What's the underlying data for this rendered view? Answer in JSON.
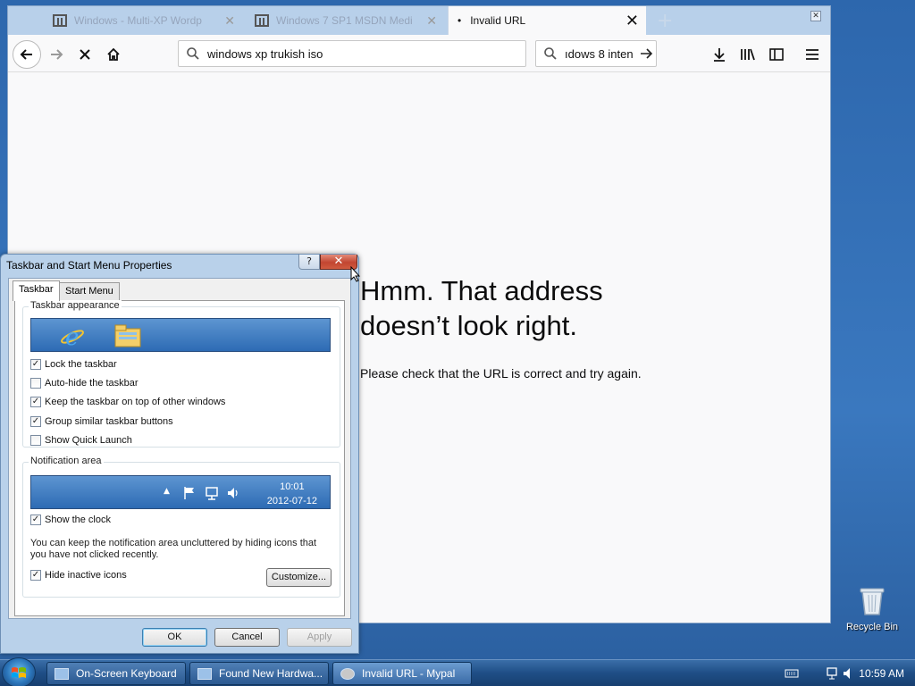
{
  "browser": {
    "tabs": [
      {
        "label": "Windows - Multi-XP Wordp",
        "close": "✕"
      },
      {
        "label": "Windows 7 SP1 MSDN Medi",
        "close": "✕"
      },
      {
        "label": "Invalid URL",
        "close": "✕"
      }
    ],
    "new_tab": "+",
    "url_value": "windows xp trukish iso",
    "search_value": "ıdows 8 inten",
    "error_title": "Hmm. That address doesn’t look right.",
    "error_desc": "Please check that the URL is correct and try again."
  },
  "dialog": {
    "title": "Taskbar and Start Menu Properties",
    "help": "?",
    "tabs": [
      "Taskbar",
      "Start Menu"
    ],
    "appearance_group": "Taskbar appearance",
    "options": [
      {
        "label": "Lock the taskbar",
        "checked": true
      },
      {
        "label": "Auto-hide the taskbar",
        "checked": false
      },
      {
        "label": "Keep the taskbar on top of other windows",
        "checked": true
      },
      {
        "label": "Group similar taskbar buttons",
        "checked": true
      },
      {
        "label": "Show Quick Launch",
        "checked": false
      }
    ],
    "notification_group": "Notification area",
    "preview_time": "10:01",
    "preview_date": "2012-07-12",
    "show_clock": "Show the clock",
    "note": "You can keep the notification area uncluttered by hiding icons that you have not clicked recently.",
    "hide_inactive": "Hide inactive icons",
    "customize": "Customize...",
    "ok": "OK",
    "cancel": "Cancel",
    "apply": "Apply"
  },
  "taskbar": {
    "buttons": [
      "On-Screen Keyboard",
      "Found New Hardwa...",
      "Invalid URL - Mypal"
    ],
    "clock": "10:59 AM"
  },
  "desktop": {
    "recycle_bin": "Recycle Bin"
  },
  "colors": {
    "desktop": "#2d67ad",
    "taskbar": "#1f4e86",
    "dialog_frame": "#b9d1ea",
    "close_red": "#c24631"
  }
}
